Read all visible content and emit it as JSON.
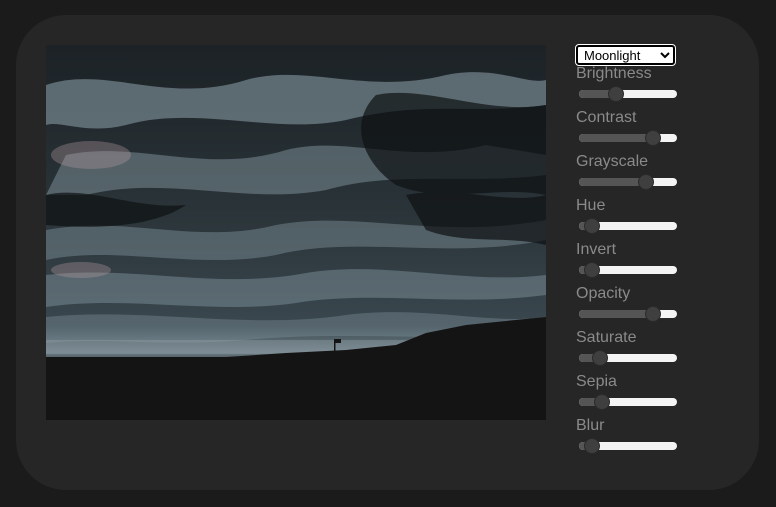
{
  "filter_preset": {
    "selected": "Moonlight"
  },
  "controls": [
    {
      "label": "Brightness",
      "value_fraction": 0.35
    },
    {
      "label": "Contrast",
      "value_fraction": 0.8
    },
    {
      "label": "Grayscale",
      "value_fraction": 0.72
    },
    {
      "label": "Hue",
      "value_fraction": 0.06
    },
    {
      "label": "Invert",
      "value_fraction": 0.06
    },
    {
      "label": "Opacity",
      "value_fraction": 0.8
    },
    {
      "label": "Saturate",
      "value_fraction": 0.16
    },
    {
      "label": "Sepia",
      "value_fraction": 0.18
    },
    {
      "label": "Blur",
      "value_fraction": 0.06
    }
  ],
  "colors": {
    "page_background": "#1b1b1b",
    "panel_background": "#262626",
    "label_text": "#8a8a8a"
  }
}
